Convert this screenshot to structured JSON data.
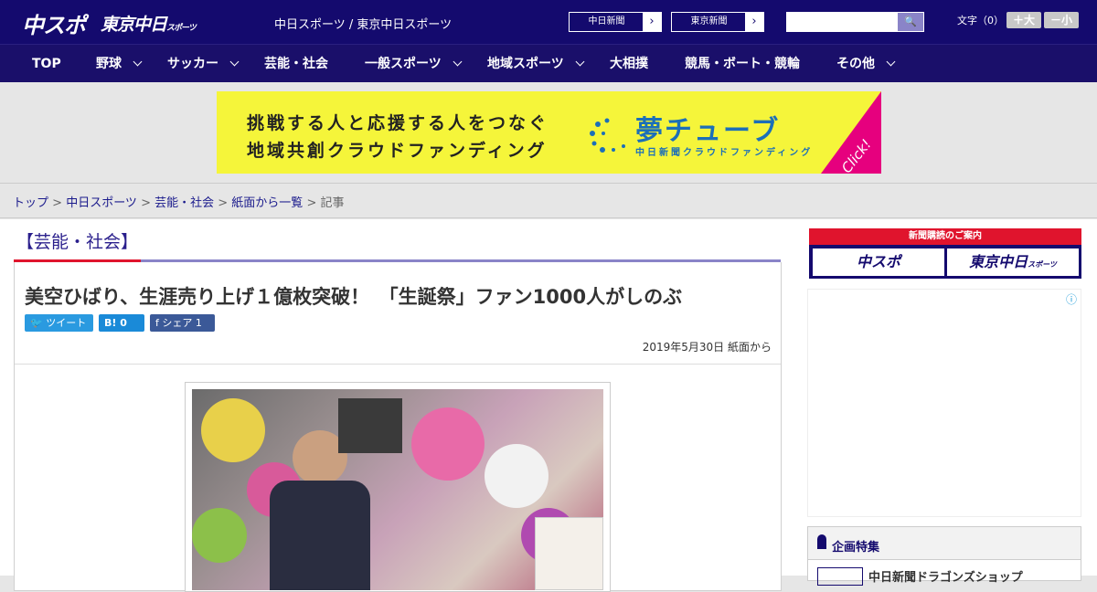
{
  "header": {
    "logo_text": "中スポ",
    "logo2_text": "東京中日",
    "logo2_small": "スポーツ",
    "site_name": "中日スポーツ / 東京中日スポーツ",
    "link1": "中日新聞",
    "link2": "東京新聞",
    "arrow": "›",
    "search_button": "🔍",
    "font_size_label": "文字（0）",
    "font_larger": "＋大",
    "font_smaller": "－小"
  },
  "nav": {
    "items": [
      "TOP",
      "野球",
      "サッカー",
      "芸能・社会",
      "一般スポーツ",
      "地域スポーツ",
      "大相撲",
      "競馬・ボート・競輪",
      "その他"
    ]
  },
  "banner": {
    "line1": "挑戦する人と応援する人をつなぐ",
    "line2": "地域共創クラウドファンディング",
    "brand": "夢チューブ",
    "brand_sub": "中日新聞クラウドファンディング",
    "click": "Click!"
  },
  "breadcrumb": {
    "items": [
      "トップ",
      "中日スポーツ",
      "芸能・社会",
      "紙面から一覧"
    ],
    "sep": " > ",
    "current": "記事"
  },
  "article": {
    "category": "【芸能・社会】",
    "title": "美空ひばり、生涯売り上げ１億枚突破！　「生誕祭」ファン1000人がしのぶ",
    "tweet": "ツイート",
    "hatena": "B! 0",
    "facebook": "シェア 1",
    "date": "2019年5月30日 紙面から"
  },
  "sidebar": {
    "subscribe_top": "新聞購読のご案内",
    "sub1": "中スポ",
    "sub2": "東京中日",
    "sub2_small": "スポーツ",
    "ad_info": "ⓘ",
    "feature_title": "企画特集",
    "feature_item": "中日新聞ドラゴンズショップ"
  },
  "colors": {
    "header_bg": "#140a6e",
    "accent_red": "#e0142d",
    "link": "#1a1a8c",
    "banner_bg": "#f5f53a"
  }
}
